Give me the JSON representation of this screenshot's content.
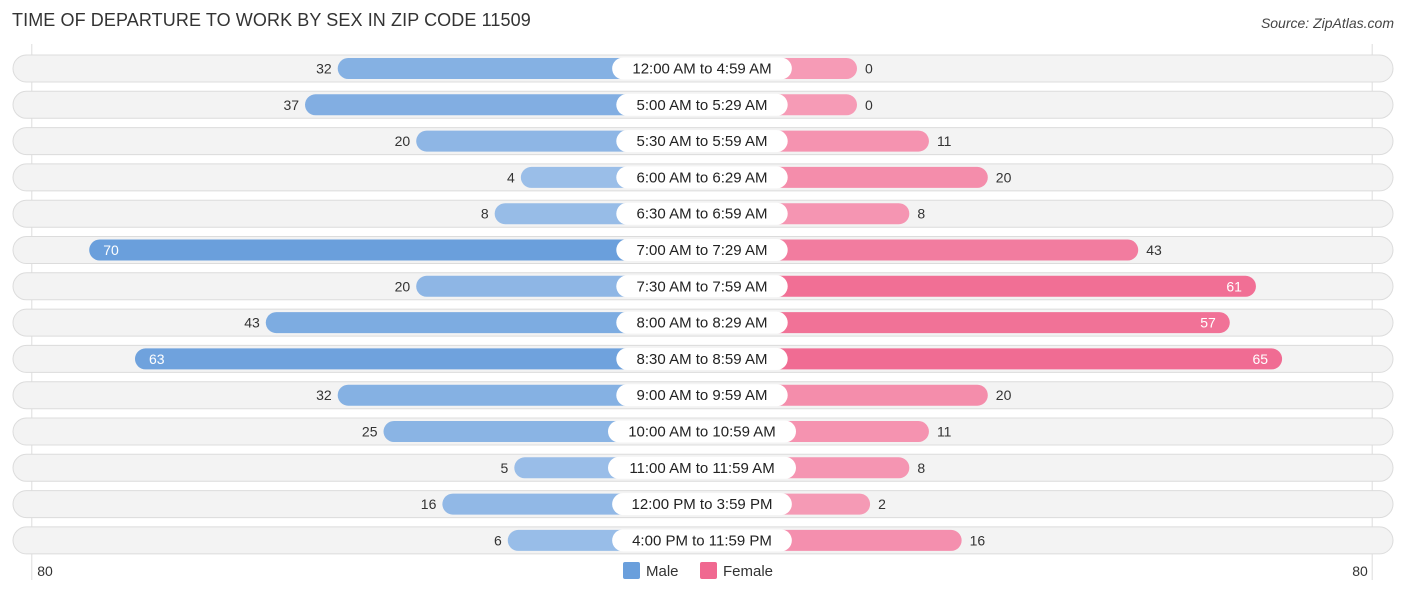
{
  "chart_data": {
    "type": "bar",
    "orientation": "horizontal-diverging",
    "title": "TIME OF DEPARTURE TO WORK BY SEX IN ZIP CODE 11509",
    "source": "Source: ZipAtlas.com",
    "categories": [
      "12:00 AM to 4:59 AM",
      "5:00 AM to 5:29 AM",
      "5:30 AM to 5:59 AM",
      "6:00 AM to 6:29 AM",
      "6:30 AM to 6:59 AM",
      "7:00 AM to 7:29 AM",
      "7:30 AM to 7:59 AM",
      "8:00 AM to 8:29 AM",
      "8:30 AM to 8:59 AM",
      "9:00 AM to 9:59 AM",
      "10:00 AM to 10:59 AM",
      "11:00 AM to 11:59 AM",
      "12:00 PM to 3:59 PM",
      "4:00 PM to 11:59 PM"
    ],
    "series": [
      {
        "name": "Male",
        "color": "#6a9fdc",
        "color_light": "#a9c8ec",
        "values": [
          32,
          37,
          20,
          4,
          8,
          70,
          20,
          43,
          63,
          32,
          25,
          5,
          16,
          6
        ]
      },
      {
        "name": "Female",
        "color": "#f06890",
        "color_light": "#f7a8c0",
        "values": [
          0,
          0,
          11,
          20,
          8,
          43,
          61,
          57,
          65,
          20,
          11,
          8,
          2,
          16
        ]
      }
    ],
    "xlim": [
      80,
      80
    ],
    "axis_labels": {
      "left": "80",
      "right": "80"
    },
    "legend": {
      "position": "bottom-center",
      "entries": [
        "Male",
        "Female"
      ]
    },
    "grid": false
  }
}
